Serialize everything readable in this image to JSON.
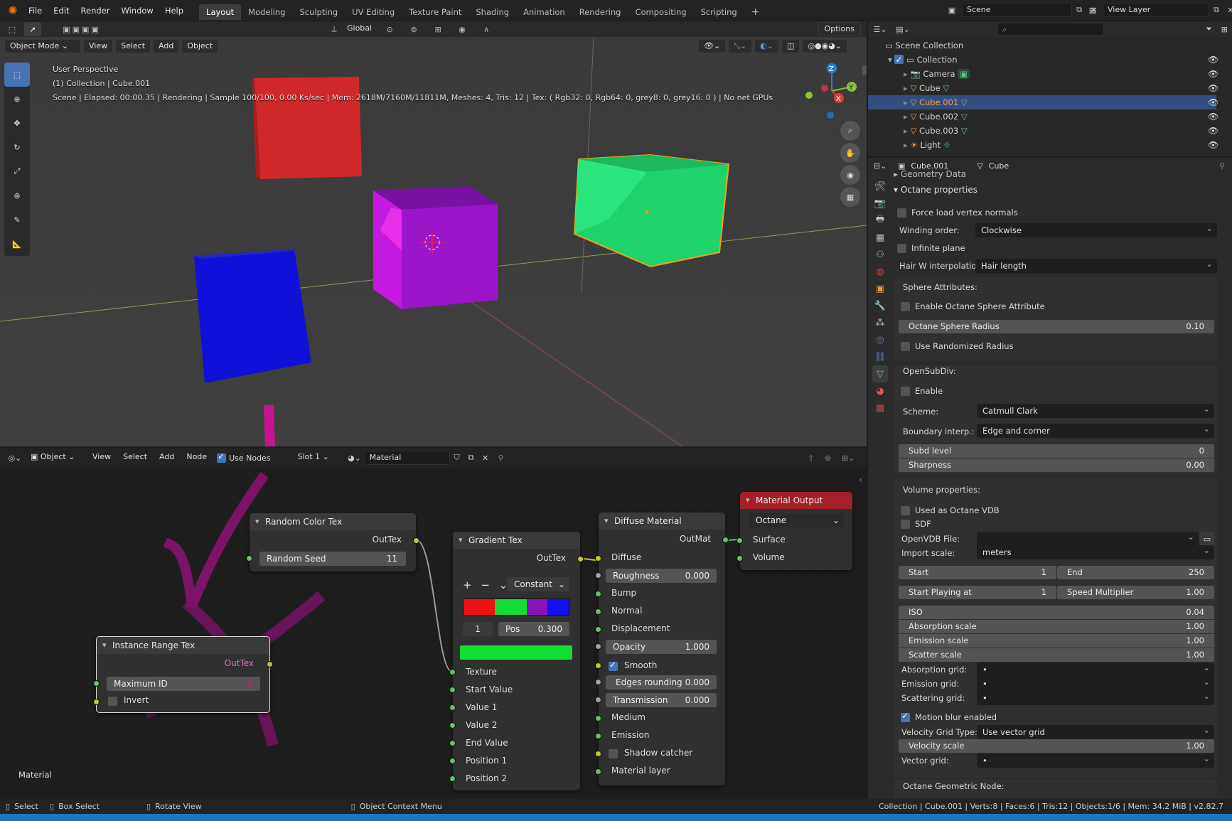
{
  "menu": {
    "file": "File",
    "edit": "Edit",
    "render": "Render",
    "window": "Window",
    "help": "Help"
  },
  "workspaces": [
    "Layout",
    "Modeling",
    "Sculpting",
    "UV Editing",
    "Texture Paint",
    "Shading",
    "Animation",
    "Rendering",
    "Compositing",
    "Scripting"
  ],
  "scene": {
    "name": "Scene",
    "view_layer": "View Layer"
  },
  "toolbar3d": {
    "transform": "Global",
    "options": "Options"
  },
  "viewport": {
    "mode": "Object Mode",
    "view": "View",
    "select": "Select",
    "add": "Add",
    "object": "Object",
    "overlay_line1": "User Perspective",
    "overlay_line2": "(1) Collection | Cube.001",
    "overlay_line3": "Scene | Elapsed: 00:00.35 |  Rendering | Sample 100/100, 0.00 Ks/sec | Mem: 2618M/7160M/11811M, Meshes: 4, Tris: 12 | Tex: ( Rgb32: 0, Rgb64: 0, grey8: 0, grey16: 0 ) | No net GPUs",
    "gizmo": {
      "x": "X",
      "y": "Y",
      "z": "Z"
    }
  },
  "node_editor": {
    "type": "Object",
    "view": "View",
    "select": "Select",
    "add": "Add",
    "node": "Node",
    "use_nodes": "Use Nodes",
    "slot": "Slot 1",
    "material": "Material",
    "corner_label": "Material"
  },
  "nodes": {
    "random_color": {
      "title": "Random Color Tex",
      "out": "OutTex",
      "seed_label": "Random Seed",
      "seed": "11"
    },
    "instance_range": {
      "title": "Instance Range Tex",
      "out": "OutTex",
      "max_label": "Maximum ID",
      "max": "0",
      "invert": "Invert"
    },
    "gradient": {
      "title": "Gradient Tex",
      "out": "OutTex",
      "interp": "Constant",
      "index": "1",
      "pos_label": "Pos",
      "pos": "0.300",
      "inputs": [
        "Texture",
        "Start Value",
        "Value 1",
        "Value 2",
        "End Value",
        "Position 1",
        "Position 2"
      ]
    },
    "diffuse": {
      "title": "Diffuse Material",
      "out": "OutMat",
      "diffuse": "Diffuse",
      "roughness_label": "Roughness",
      "roughness": "0.000",
      "bump": "Bump",
      "normal": "Normal",
      "displacement": "Displacement",
      "opacity_label": "Opacity",
      "opacity": "1.000",
      "smooth": "Smooth",
      "edges_label": "Edges rounding",
      "edges": "0.000",
      "transmission_label": "Transmission",
      "transmission": "0.000",
      "medium": "Medium",
      "emission": "Emission",
      "shadow": "Shadow catcher",
      "layer": "Material layer"
    },
    "output": {
      "title": "Material Output",
      "renderer": "Octane",
      "surface": "Surface",
      "volume": "Volume"
    }
  },
  "outliner": {
    "root": "Scene Collection",
    "collection": "Collection",
    "items": [
      "Camera",
      "Cube",
      "Cube.001",
      "Cube.002",
      "Cube.003",
      "Light"
    ]
  },
  "properties": {
    "object": "Cube.001",
    "mesh": "Cube",
    "geometry_data": "Geometry Data",
    "octane_props": "Octane properties",
    "force_normals": "Force load vertex normals",
    "winding_label": "Winding order:",
    "winding": "Clockwise",
    "infinite_plane": "Infinite plane",
    "hair_label": "Hair W interpolation:",
    "hair": "Hair length",
    "sphere_attr": "Sphere Attributes:",
    "enable_sphere": "Enable Octane Sphere Attribute",
    "sphere_radius_label": "Octane Sphere Radius",
    "sphere_radius": "0.10",
    "randomized_radius": "Use Randomized Radius",
    "opensubdiv": "OpenSubDiv:",
    "enable": "Enable",
    "scheme_label": "Scheme:",
    "scheme": "Catmull Clark",
    "boundary_label": "Boundary interp.:",
    "boundary": "Edge and corner",
    "subd_label": "Subd level",
    "subd": "0",
    "sharpness_label": "Sharpness",
    "sharpness": "0.00",
    "volume_props": "Volume properties:",
    "used_vdb": "Used as Octane VDB",
    "sdf": "SDF",
    "openvdb_label": "OpenVDB File:",
    "import_label": "Import scale:",
    "import": "meters",
    "start_label": "Start",
    "start": "1",
    "end_label": "End",
    "end": "250",
    "start_playing_label": "Start Playing at",
    "start_playing": "1",
    "speed_label": "Speed Multiplier",
    "speed": "1.00",
    "iso_label": "ISO",
    "iso": "0.04",
    "absorption_label": "Absorption scale",
    "absorption": "1.00",
    "emission_label": "Emission scale",
    "emission": "1.00",
    "scatter_label": "Scatter scale",
    "scatter": "1.00",
    "abs_grid": "Absorption grid:",
    "em_grid": "Emission grid:",
    "sc_grid": "Scattering grid:",
    "motion_blur": "Motion blur enabled",
    "vel_type_label": "Velocity Grid Type:",
    "vel_type": "Use vector grid",
    "vel_scale_label": "Velocity scale",
    "vel_scale": "1.00",
    "vector_grid": "Vector grid:",
    "geo_node": "Octane Geometric Node:"
  },
  "status": {
    "select": "Select",
    "box_select": "Box Select",
    "rotate": "Rotate View",
    "context": "Object Context Menu",
    "info": "Collection | Cube.001 | Verts:8 | Faces:6 | Tris:12 | Objects:1/6 | Mem: 34.2 MiB | v2.82.7"
  },
  "colors": {
    "accent": "#4772b3",
    "selected_row": "#334d80",
    "socket_yellow": "#c8c332",
    "socket_green": "#61c461",
    "annotation": "#c8148c"
  }
}
